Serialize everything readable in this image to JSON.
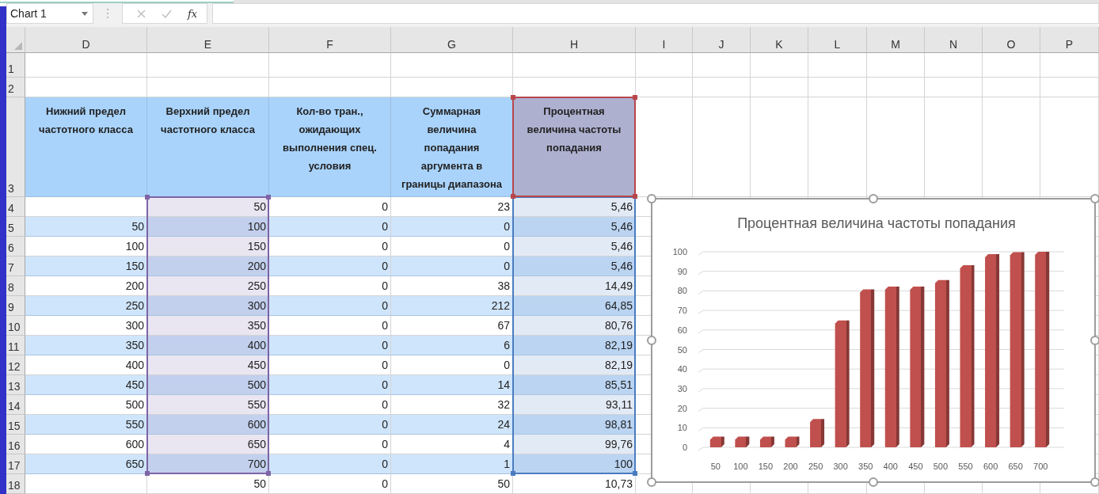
{
  "formula_bar": {
    "name_box": "Chart 1",
    "function_label": "fx"
  },
  "sheet": {
    "columns": [
      {
        "letter": "D"
      },
      {
        "letter": "E",
        "range": {
          "color": "#7e64a6"
        }
      },
      {
        "letter": "F"
      },
      {
        "letter": "G"
      },
      {
        "letter": "H",
        "range": {
          "color": "#4a7cc0"
        },
        "header_range": {
          "color": "#b8464b"
        }
      },
      {
        "letter": "I"
      },
      {
        "letter": "J"
      },
      {
        "letter": "K"
      },
      {
        "letter": "L"
      },
      {
        "letter": "M"
      },
      {
        "letter": "N"
      },
      {
        "letter": "O"
      },
      {
        "letter": "P"
      }
    ],
    "empty_rows": [
      {
        "number": "1"
      },
      {
        "number": "2"
      }
    ],
    "header_row": {
      "number": "3",
      "cells": [
        "Нижний предел частотного класса",
        "Верхний предел частотного класса",
        "Кол-во тран., ожидающих выполнения спец. условия",
        "Суммарная величина попадания аргумента в границы диапазона",
        "Процентная величина частоты попадания"
      ]
    },
    "rows": [
      {
        "number": "4",
        "banded": false,
        "in_range": true,
        "cells": [
          null,
          "50",
          "0",
          "23",
          "5,46"
        ]
      },
      {
        "number": "5",
        "banded": true,
        "in_range": true,
        "cells": [
          "50",
          "100",
          "0",
          "0",
          "5,46"
        ]
      },
      {
        "number": "6",
        "banded": false,
        "in_range": true,
        "cells": [
          "100",
          "150",
          "0",
          "0",
          "5,46"
        ]
      },
      {
        "number": "7",
        "banded": true,
        "in_range": true,
        "cells": [
          "150",
          "200",
          "0",
          "0",
          "5,46"
        ]
      },
      {
        "number": "8",
        "banded": false,
        "in_range": true,
        "cells": [
          "200",
          "250",
          "0",
          "38",
          "14,49"
        ]
      },
      {
        "number": "9",
        "banded": true,
        "in_range": true,
        "cells": [
          "250",
          "300",
          "0",
          "212",
          "64,85"
        ]
      },
      {
        "number": "10",
        "banded": false,
        "in_range": true,
        "cells": [
          "300",
          "350",
          "0",
          "67",
          "80,76"
        ]
      },
      {
        "number": "11",
        "banded": true,
        "in_range": true,
        "cells": [
          "350",
          "400",
          "0",
          "6",
          "82,19"
        ]
      },
      {
        "number": "12",
        "banded": false,
        "in_range": true,
        "cells": [
          "400",
          "450",
          "0",
          "0",
          "82,19"
        ]
      },
      {
        "number": "13",
        "banded": true,
        "in_range": true,
        "cells": [
          "450",
          "500",
          "0",
          "14",
          "85,51"
        ]
      },
      {
        "number": "14",
        "banded": false,
        "in_range": true,
        "cells": [
          "500",
          "550",
          "0",
          "32",
          "93,11"
        ]
      },
      {
        "number": "15",
        "banded": true,
        "in_range": true,
        "cells": [
          "550",
          "600",
          "0",
          "24",
          "98,81"
        ]
      },
      {
        "number": "16",
        "banded": false,
        "in_range": true,
        "cells": [
          "600",
          "650",
          "0",
          "4",
          "99,76"
        ]
      },
      {
        "number": "17",
        "banded": true,
        "in_range": true,
        "cells": [
          "650",
          "700",
          "0",
          "1",
          "100"
        ]
      },
      {
        "number": "18",
        "banded": false,
        "in_range": false,
        "cells": [
          null,
          "50",
          "0",
          "50",
          "10,73"
        ]
      }
    ]
  },
  "chart": {
    "selected": true,
    "chart_data": {
      "type": "bar",
      "title": "Процентная величина частоты попадания",
      "categories": [
        "50",
        "100",
        "150",
        "200",
        "250",
        "300",
        "350",
        "400",
        "450",
        "500",
        "550",
        "600",
        "650",
        "700"
      ],
      "series": [
        {
          "color": "#c0504d",
          "values": [
            5.46,
            5.46,
            5.46,
            5.46,
            14.49,
            64.85,
            80.76,
            82.19,
            82.19,
            85.51,
            93.11,
            98.81,
            99.76,
            100
          ]
        }
      ],
      "ylim": [
        0,
        100
      ],
      "grid": true,
      "yticks": [
        0,
        10,
        20,
        30,
        40,
        50,
        60,
        70,
        80,
        90,
        100
      ]
    }
  }
}
